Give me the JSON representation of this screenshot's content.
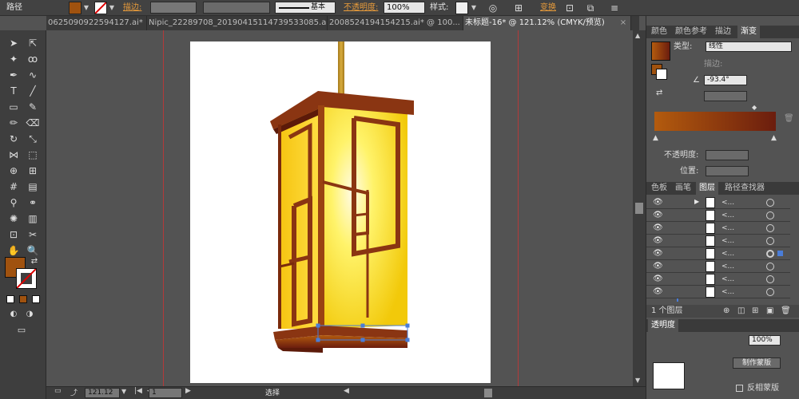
{
  "control_bar": {
    "selection_label": "路径",
    "stroke_label": "描边:",
    "brush_label": "基本",
    "opacity_label": "不透明度:",
    "opacity_value": "100%",
    "style_label": "样式:",
    "transform_label": "变换",
    "fill_color": "#a0520f"
  },
  "tabs": [
    {
      "label": "0625090922594127.ai*",
      "active": false
    },
    {
      "label": "Nipic_22289708_20190415114739533085.ai*",
      "active": false
    },
    {
      "label": "2008524194154215.ai* @ 100...",
      "active": false
    },
    {
      "label": "未标题-16* @ 121.12% (CMYK/预览)",
      "active": true
    }
  ],
  "gradient_panel": {
    "tabs": [
      "颜色",
      "颜色参考",
      "描边",
      "渐变"
    ],
    "type_label": "类型:",
    "type_value": "线性",
    "stroke_label": "描边:",
    "angle_value": "-93.4°",
    "opacity_label": "不透明度:",
    "position_label": "位置:",
    "gradient_start": "#b35b0e",
    "gradient_end": "#6b1d0e"
  },
  "layers_panel": {
    "tabs": [
      "色板",
      "画笔",
      "图层",
      "路径查找器"
    ],
    "rows": [
      "<...",
      "<...",
      "<...",
      "<...",
      "<...",
      "<...",
      "<...",
      "<..."
    ],
    "footer_label": "1 个图层"
  },
  "transparency_panel": {
    "tab_label": "透明度",
    "button_label": "制作蒙版",
    "checkbox_label": "反相蒙版",
    "opacity_value": "100%"
  },
  "status_bar": {
    "zoom_value": "121.12",
    "page_value": "1",
    "tool_label": "选择"
  }
}
